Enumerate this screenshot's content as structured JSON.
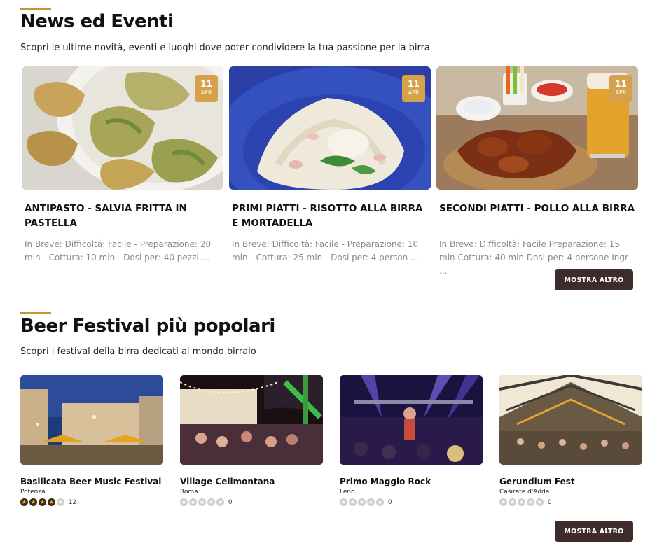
{
  "news": {
    "title": "News ed Eventi",
    "subtitle": "Scopri le ultime novità, eventi e luoghi dove poter condividere la tua passione per la birra",
    "cards": [
      {
        "day": "11",
        "month": "APR",
        "title": "ANTIPASTO - SALVIA FRITTA IN PASTELLA",
        "desc": "In Breve: Difficoltà: Facile - Preparazione: 20 min - Cottura: 10 min - Dosi per: 40 pezzi ..."
      },
      {
        "day": "11",
        "month": "APR",
        "title": "PRIMI PIATTI - RISOTTO ALLA BIRRA E MORTADELLA",
        "desc": "In Breve: Difficoltà: Facile - Preparazione: 10 min - Cottura: 25 min - Dosi per: 4 person ..."
      },
      {
        "day": "11",
        "month": "APR",
        "title": "SECONDI PIATTI - POLLO ALLA BIRRA",
        "desc": "In Breve: Difficoltà: Facile Preparazione: 15 min Cottura: 40 min Dosi per: 4 persone Ingr ..."
      }
    ],
    "more_label": "MOSTRA ALTRO"
  },
  "festivals": {
    "title": "Beer Festival più popolari",
    "subtitle": "Scopri i festival della birra dedicati al mondo birraio",
    "cards": [
      {
        "name": "Basilicata Beer Music Festival",
        "city": "Potenza",
        "rating": 4,
        "count": "12"
      },
      {
        "name": "Village Celimontana",
        "city": "Roma",
        "rating": 0,
        "count": "0"
      },
      {
        "name": "Primo Maggio Rock",
        "city": "Leno",
        "rating": 0,
        "count": "0"
      },
      {
        "name": "Gerundium Fest",
        "city": "Casirate d'Adda",
        "rating": 0,
        "count": "0"
      }
    ],
    "more_label": "MOSTRA ALTRO"
  },
  "colors": {
    "accent": "#c8923a",
    "badge": "#d5a14a",
    "button": "#3e2c2c",
    "muted_text": "#8a8a8a"
  },
  "star_glyph": "★"
}
